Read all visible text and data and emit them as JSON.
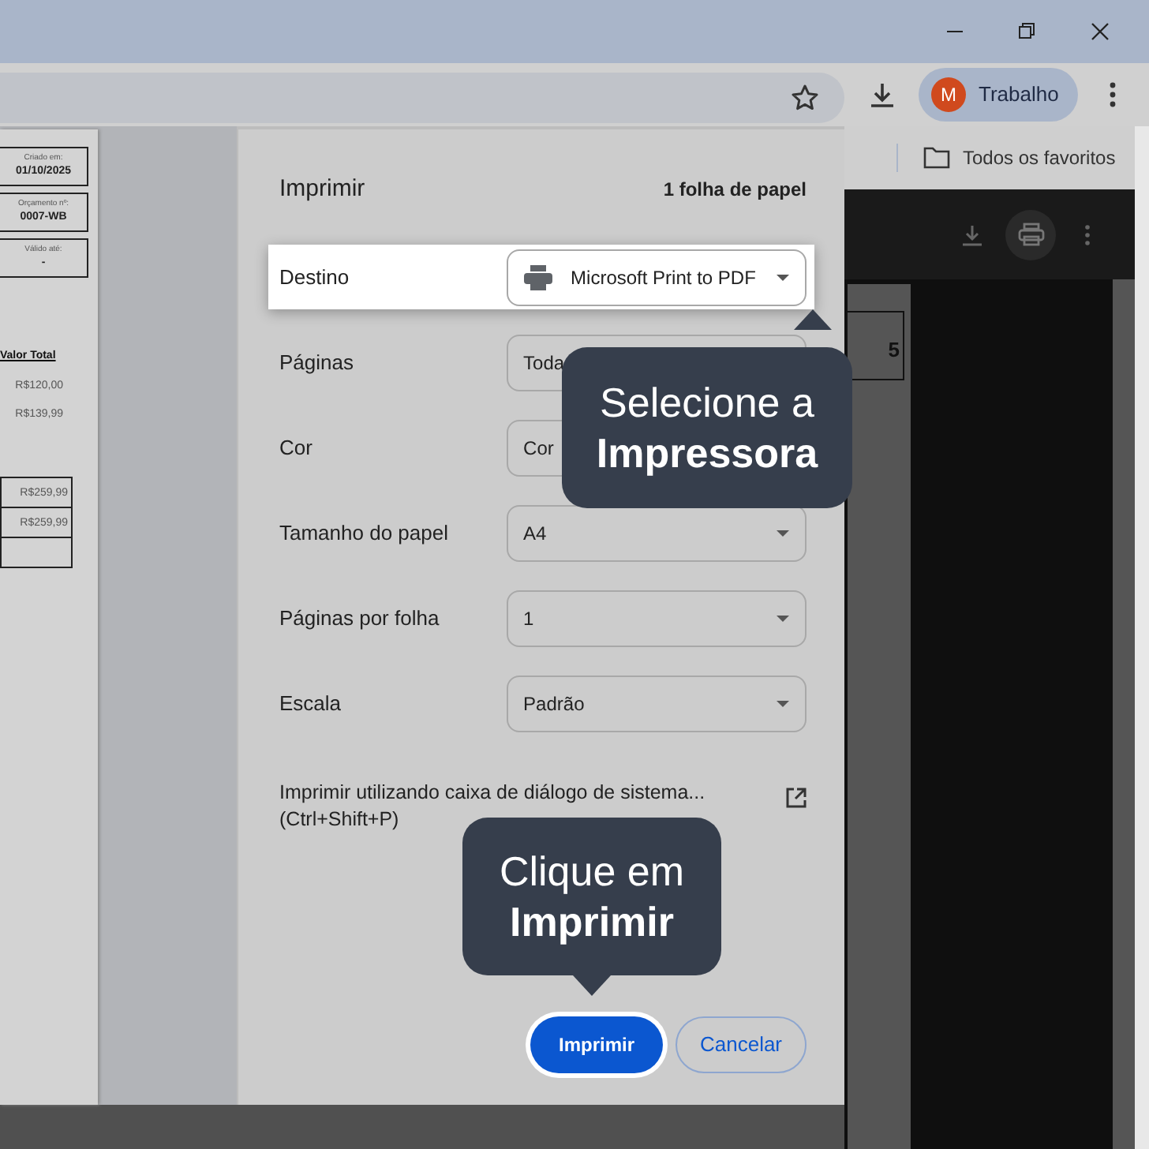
{
  "browser": {
    "profile": {
      "initial": "M",
      "label": "Trabalho"
    },
    "bookmarks": {
      "label": "Todos os favoritos"
    }
  },
  "document_preview": {
    "fields": [
      {
        "label": "Criado em:",
        "value": "01/10/2025"
      },
      {
        "label": "Orçamento nº:",
        "value": "0007-WB"
      },
      {
        "label": "Válido até:",
        "value": "-"
      }
    ],
    "total_heading": "Valor Total",
    "item_totals": [
      "R$120,00",
      "R$139,99"
    ],
    "summary": [
      "R$259,99",
      "R$259,99"
    ]
  },
  "right_page": {
    "fragment": "5"
  },
  "print_dialog": {
    "title": "Imprimir",
    "sheet_count": "1 folha de papel",
    "settings": [
      {
        "label": "Destino",
        "value": "Microsoft Print to PDF",
        "kind": "printer",
        "highlighted": true
      },
      {
        "label": "Páginas",
        "value": "Toda",
        "kind": "select",
        "highlighted": false
      },
      {
        "label": "Cor",
        "value": "Cor",
        "kind": "select",
        "highlighted": false
      },
      {
        "label": "Tamanho do papel",
        "value": "A4",
        "kind": "select",
        "highlighted": false
      },
      {
        "label": "Páginas por folha",
        "value": "1",
        "kind": "select",
        "highlighted": false
      },
      {
        "label": "Escala",
        "value": "Padrão",
        "kind": "select",
        "highlighted": false
      }
    ],
    "system_dialog": {
      "text": "Imprimir utilizando caixa de diálogo de sistema...",
      "shortcut": "(Ctrl+Shift+P)"
    },
    "buttons": [
      {
        "label": "Imprimir",
        "kind": "primary",
        "highlighted": true
      },
      {
        "label": "Cancelar",
        "kind": "secondary",
        "highlighted": false
      }
    ]
  },
  "callouts": [
    {
      "lines": [
        "Selecione a",
        "Impressora"
      ]
    },
    {
      "lines": [
        "Clique em",
        "Imprimir"
      ]
    }
  ]
}
